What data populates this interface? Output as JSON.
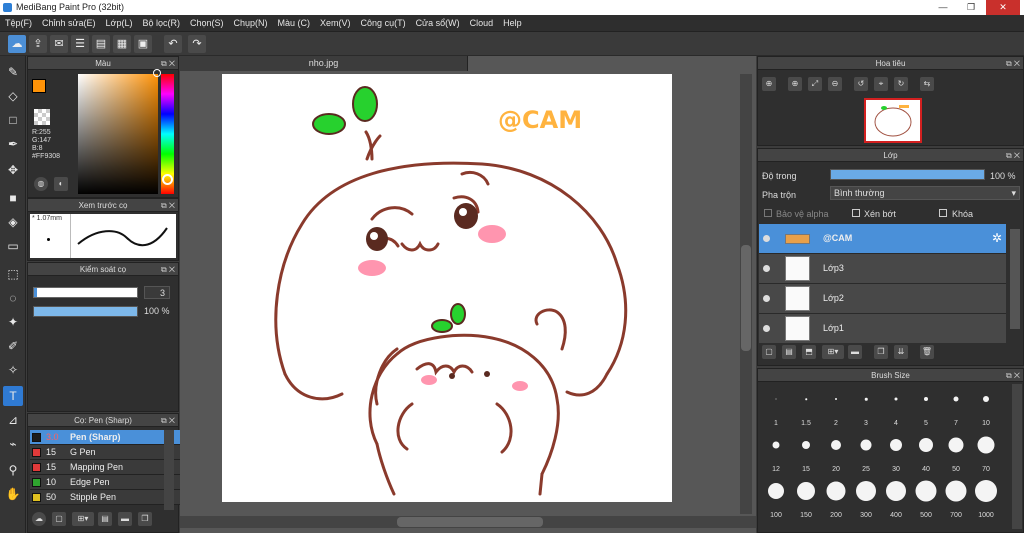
{
  "window": {
    "title": "MediBang Paint Pro (32bit)",
    "min": "—",
    "max": "❐",
    "close": "✕"
  },
  "menu": [
    "Tệp(F)",
    "Chỉnh sửa(E)",
    "Lớp(L)",
    "Bộ lọc(R)",
    "Chọn(S)",
    "Chụp(N)",
    "Màu (C)",
    "Xem(V)",
    "Công cụ(T)",
    "Cửa sổ(W)",
    "Cloud",
    "Help"
  ],
  "color_panel": {
    "title": "Màu",
    "values": [
      "R:255",
      "G:147",
      "B:8"
    ],
    "hex": "#FF9308",
    "fg": "#FF9308",
    "bg": "#FFFFFF"
  },
  "brush_preview": {
    "title": "Xem trước cọ",
    "size": "1.07mm"
  },
  "brush_control": {
    "title": "Kiểm soát cọ",
    "size": "3",
    "opacity": "100 %",
    "opacity_value": 100
  },
  "brush_list": {
    "title": "Cọ: Pen (Sharp)",
    "items": [
      {
        "size": "3.0",
        "name": "Pen (Sharp)",
        "color": "#1c1c1c"
      },
      {
        "size": "15",
        "name": "G Pen",
        "color": "#e03a3a"
      },
      {
        "size": "15",
        "name": "Mapping Pen",
        "color": "#e03a3a"
      },
      {
        "size": "10",
        "name": "Edge Pen",
        "color": "#2fa52f"
      },
      {
        "size": "50",
        "name": "Stipple Pen",
        "color": "#e0c020"
      }
    ]
  },
  "document": {
    "tab": "nho.jpg",
    "watermark": "@CAM"
  },
  "navigator": {
    "title": "Hoa tiêu"
  },
  "layers": {
    "title": "Lớp",
    "opacity_label": "Độ trong",
    "opacity": "100 %",
    "opacity_value": 100,
    "blend_label": "Pha trộn",
    "blend": "Bình thường",
    "protect_alpha": "Bảo vệ alpha",
    "clipping": "Xén bớt",
    "lock": "Khóa",
    "items": [
      {
        "name": "@CAM",
        "selected": true
      },
      {
        "name": "Lớp3",
        "selected": false
      },
      {
        "name": "Lớp2",
        "selected": false
      },
      {
        "name": "Lớp1",
        "selected": false
      }
    ]
  },
  "brush_size": {
    "title": "Brush Size",
    "sizes": [
      "1",
      "1.5",
      "2",
      "3",
      "4",
      "5",
      "7",
      "10",
      "12",
      "15",
      "20",
      "25",
      "30",
      "40",
      "50",
      "70",
      "100",
      "150",
      "200",
      "300",
      "400",
      "500",
      "700",
      "1000"
    ]
  }
}
